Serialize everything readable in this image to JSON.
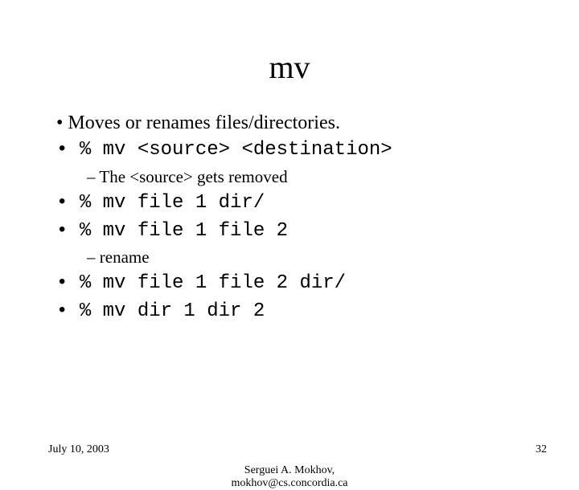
{
  "title": "mv",
  "bullets": [
    {
      "level": 1,
      "text": "Moves or renames files/directories.",
      "mono": false
    },
    {
      "level": 1,
      "text": "% mv <source> <destination>",
      "mono": true
    },
    {
      "level": 2,
      "text": "The <source> gets removed",
      "mono": false
    },
    {
      "level": 1,
      "text": "% mv file 1 dir/",
      "mono": true
    },
    {
      "level": 1,
      "text": "% mv file 1 file 2",
      "mono": true
    },
    {
      "level": 2,
      "text": "rename",
      "mono": false
    },
    {
      "level": 1,
      "text": "% mv file 1 file 2 dir/",
      "mono": true
    },
    {
      "level": 1,
      "text": "% mv dir 1 dir 2",
      "mono": true
    }
  ],
  "footer": {
    "date": "July 10, 2003",
    "author_line1": "Serguei A. Mokhov,",
    "author_line2": "mokhov@cs.concordia.ca",
    "page": "32"
  }
}
